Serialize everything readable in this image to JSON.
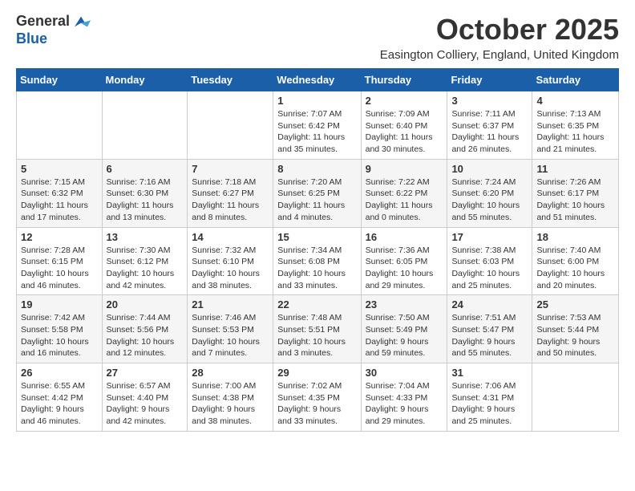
{
  "header": {
    "logo_line1": "General",
    "logo_line2": "Blue",
    "month_title": "October 2025",
    "location": "Easington Colliery, England, United Kingdom"
  },
  "weekdays": [
    "Sunday",
    "Monday",
    "Tuesday",
    "Wednesday",
    "Thursday",
    "Friday",
    "Saturday"
  ],
  "weeks": [
    [
      {
        "day": "",
        "info": ""
      },
      {
        "day": "",
        "info": ""
      },
      {
        "day": "",
        "info": ""
      },
      {
        "day": "1",
        "info": "Sunrise: 7:07 AM\nSunset: 6:42 PM\nDaylight: 11 hours\nand 35 minutes."
      },
      {
        "day": "2",
        "info": "Sunrise: 7:09 AM\nSunset: 6:40 PM\nDaylight: 11 hours\nand 30 minutes."
      },
      {
        "day": "3",
        "info": "Sunrise: 7:11 AM\nSunset: 6:37 PM\nDaylight: 11 hours\nand 26 minutes."
      },
      {
        "day": "4",
        "info": "Sunrise: 7:13 AM\nSunset: 6:35 PM\nDaylight: 11 hours\nand 21 minutes."
      }
    ],
    [
      {
        "day": "5",
        "info": "Sunrise: 7:15 AM\nSunset: 6:32 PM\nDaylight: 11 hours\nand 17 minutes."
      },
      {
        "day": "6",
        "info": "Sunrise: 7:16 AM\nSunset: 6:30 PM\nDaylight: 11 hours\nand 13 minutes."
      },
      {
        "day": "7",
        "info": "Sunrise: 7:18 AM\nSunset: 6:27 PM\nDaylight: 11 hours\nand 8 minutes."
      },
      {
        "day": "8",
        "info": "Sunrise: 7:20 AM\nSunset: 6:25 PM\nDaylight: 11 hours\nand 4 minutes."
      },
      {
        "day": "9",
        "info": "Sunrise: 7:22 AM\nSunset: 6:22 PM\nDaylight: 11 hours\nand 0 minutes."
      },
      {
        "day": "10",
        "info": "Sunrise: 7:24 AM\nSunset: 6:20 PM\nDaylight: 10 hours\nand 55 minutes."
      },
      {
        "day": "11",
        "info": "Sunrise: 7:26 AM\nSunset: 6:17 PM\nDaylight: 10 hours\nand 51 minutes."
      }
    ],
    [
      {
        "day": "12",
        "info": "Sunrise: 7:28 AM\nSunset: 6:15 PM\nDaylight: 10 hours\nand 46 minutes."
      },
      {
        "day": "13",
        "info": "Sunrise: 7:30 AM\nSunset: 6:12 PM\nDaylight: 10 hours\nand 42 minutes."
      },
      {
        "day": "14",
        "info": "Sunrise: 7:32 AM\nSunset: 6:10 PM\nDaylight: 10 hours\nand 38 minutes."
      },
      {
        "day": "15",
        "info": "Sunrise: 7:34 AM\nSunset: 6:08 PM\nDaylight: 10 hours\nand 33 minutes."
      },
      {
        "day": "16",
        "info": "Sunrise: 7:36 AM\nSunset: 6:05 PM\nDaylight: 10 hours\nand 29 minutes."
      },
      {
        "day": "17",
        "info": "Sunrise: 7:38 AM\nSunset: 6:03 PM\nDaylight: 10 hours\nand 25 minutes."
      },
      {
        "day": "18",
        "info": "Sunrise: 7:40 AM\nSunset: 6:00 PM\nDaylight: 10 hours\nand 20 minutes."
      }
    ],
    [
      {
        "day": "19",
        "info": "Sunrise: 7:42 AM\nSunset: 5:58 PM\nDaylight: 10 hours\nand 16 minutes."
      },
      {
        "day": "20",
        "info": "Sunrise: 7:44 AM\nSunset: 5:56 PM\nDaylight: 10 hours\nand 12 minutes."
      },
      {
        "day": "21",
        "info": "Sunrise: 7:46 AM\nSunset: 5:53 PM\nDaylight: 10 hours\nand 7 minutes."
      },
      {
        "day": "22",
        "info": "Sunrise: 7:48 AM\nSunset: 5:51 PM\nDaylight: 10 hours\nand 3 minutes."
      },
      {
        "day": "23",
        "info": "Sunrise: 7:50 AM\nSunset: 5:49 PM\nDaylight: 9 hours\nand 59 minutes."
      },
      {
        "day": "24",
        "info": "Sunrise: 7:51 AM\nSunset: 5:47 PM\nDaylight: 9 hours\nand 55 minutes."
      },
      {
        "day": "25",
        "info": "Sunrise: 7:53 AM\nSunset: 5:44 PM\nDaylight: 9 hours\nand 50 minutes."
      }
    ],
    [
      {
        "day": "26",
        "info": "Sunrise: 6:55 AM\nSunset: 4:42 PM\nDaylight: 9 hours\nand 46 minutes."
      },
      {
        "day": "27",
        "info": "Sunrise: 6:57 AM\nSunset: 4:40 PM\nDaylight: 9 hours\nand 42 minutes."
      },
      {
        "day": "28",
        "info": "Sunrise: 7:00 AM\nSunset: 4:38 PM\nDaylight: 9 hours\nand 38 minutes."
      },
      {
        "day": "29",
        "info": "Sunrise: 7:02 AM\nSunset: 4:35 PM\nDaylight: 9 hours\nand 33 minutes."
      },
      {
        "day": "30",
        "info": "Sunrise: 7:04 AM\nSunset: 4:33 PM\nDaylight: 9 hours\nand 29 minutes."
      },
      {
        "day": "31",
        "info": "Sunrise: 7:06 AM\nSunset: 4:31 PM\nDaylight: 9 hours\nand 25 minutes."
      },
      {
        "day": "",
        "info": ""
      }
    ]
  ]
}
